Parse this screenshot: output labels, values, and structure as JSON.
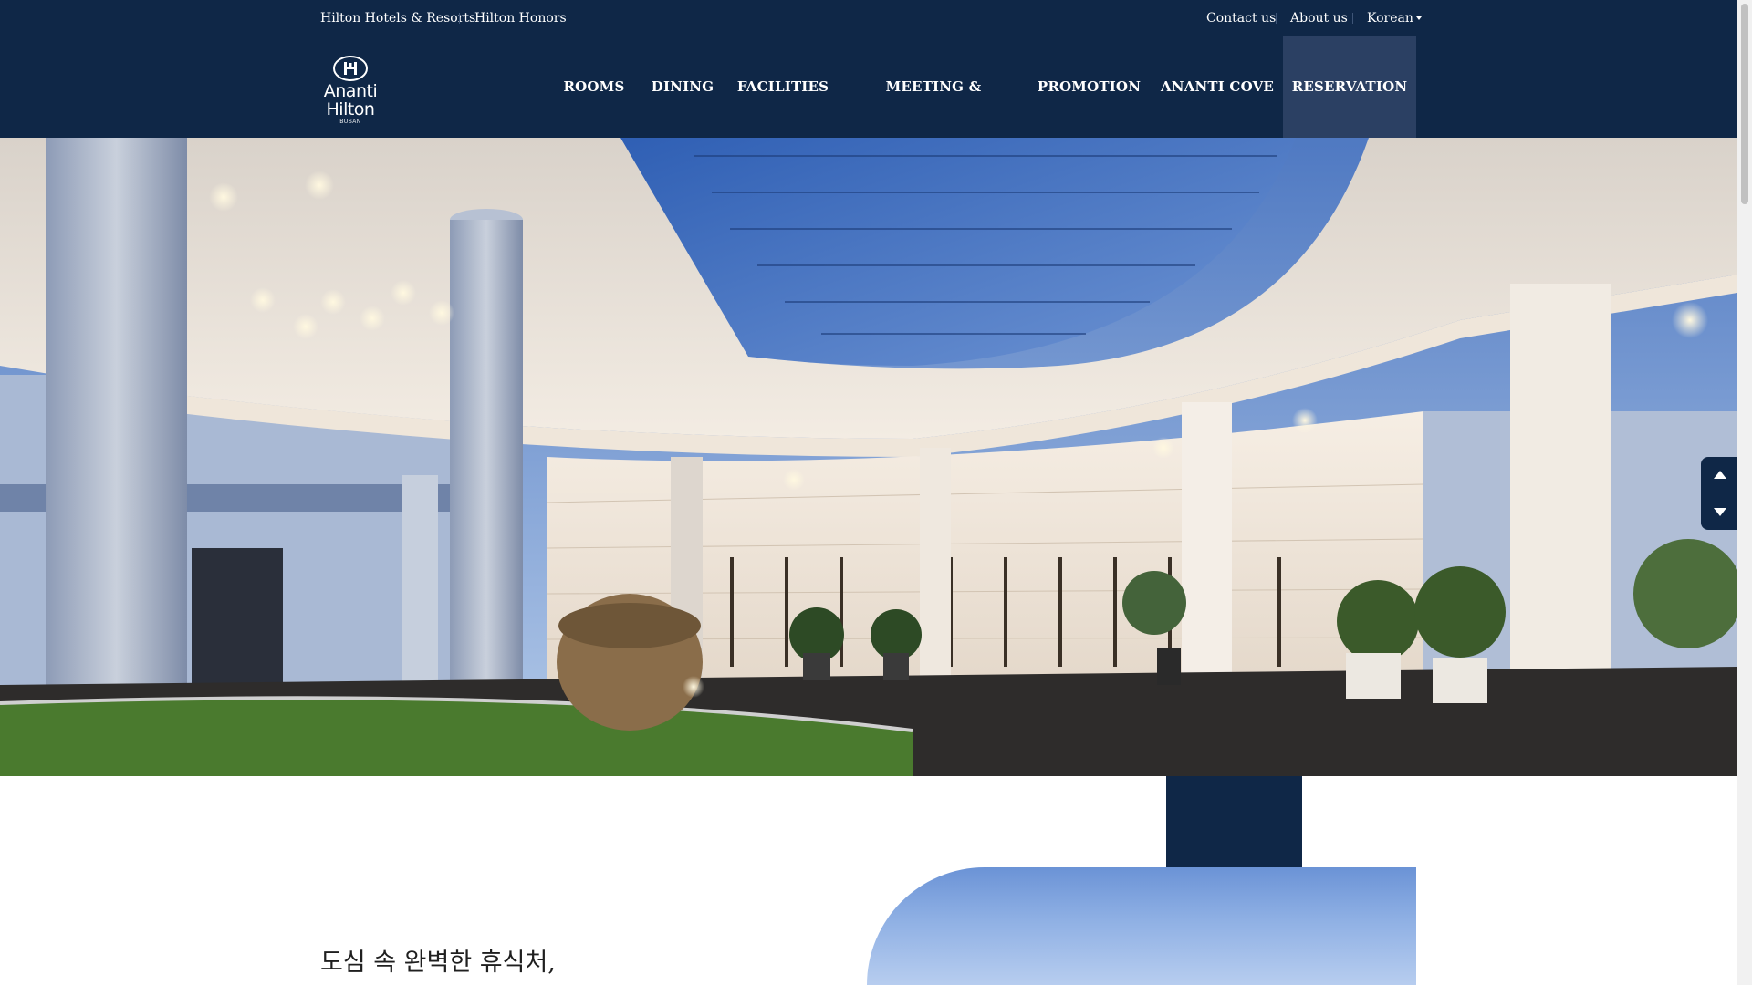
{
  "utility_bar": {
    "left_links": [
      "Hilton Hotels & Resorts",
      "Hilton Honors"
    ],
    "right_links": [
      "Contact us",
      "About us"
    ],
    "language": "Korean"
  },
  "logo": {
    "line1": "Ananti",
    "line2": "Hilton",
    "subline": "BUSAN"
  },
  "nav": {
    "items": [
      "ROOMS",
      "DINING",
      "FACILITIES",
      "MEETING & WEDDING",
      "PROMOTION",
      "ANANTI COVE",
      "RESERVATION"
    ],
    "active": "RESERVATION"
  },
  "hero": {
    "slide_controls": [
      "up",
      "down"
    ]
  },
  "intro": {
    "headline": "도심 속 완벽한 휴식처,"
  },
  "colors": {
    "navy": "#0f2747",
    "active_nav": "#2b4063",
    "white": "#ffffff"
  },
  "icons": [
    "hilton-logo-icon",
    "caret-down-icon",
    "arrow-up-icon",
    "arrow-down-icon"
  ]
}
